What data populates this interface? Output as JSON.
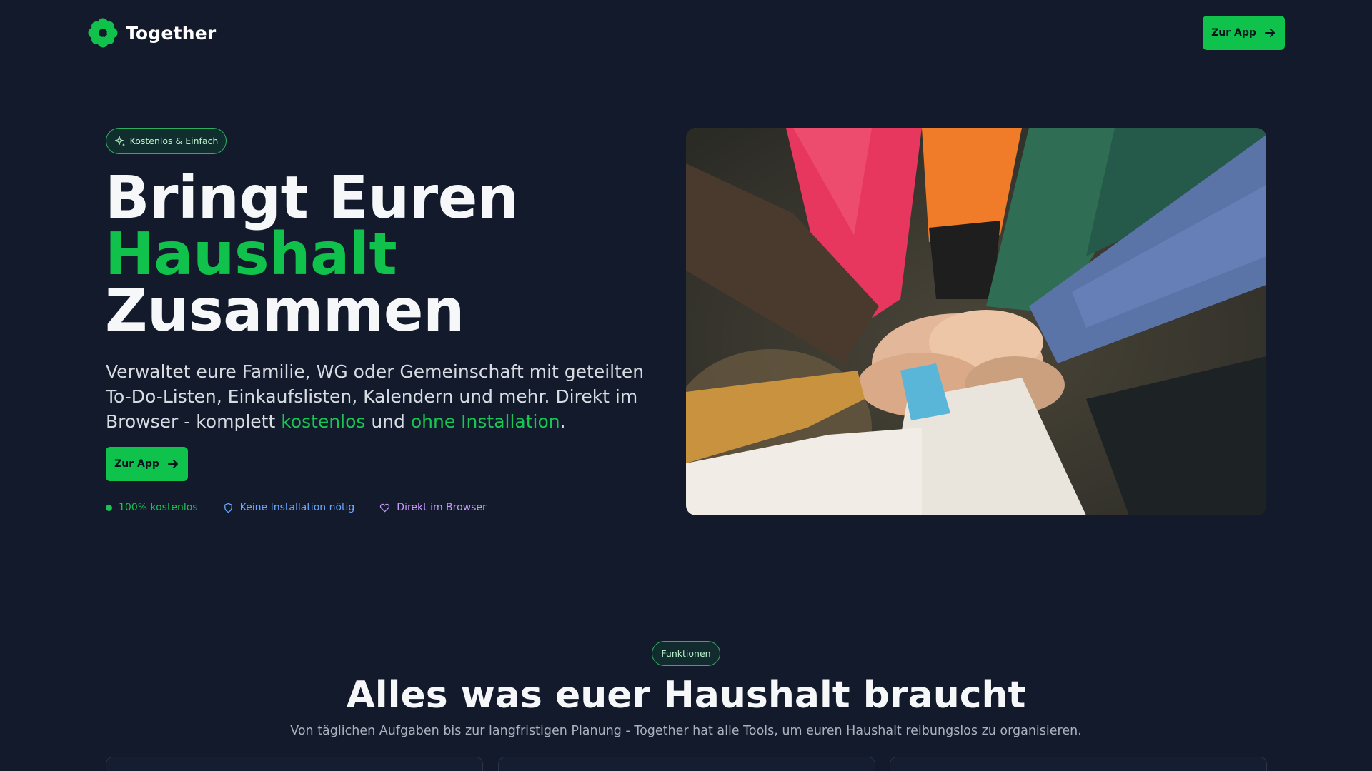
{
  "brand": {
    "name": "Together",
    "accent": "#10c24b",
    "background": "#121a2b"
  },
  "header": {
    "cta_label": "Zur App",
    "cta_icon": "arrow-right-icon"
  },
  "hero": {
    "badge": "Kostenlos & Einfach",
    "title_line1": "Bringt Euren",
    "title_line2": "Haushalt",
    "title_line3": "Zusammen",
    "desc_part1": "Verwaltet eure Familie, WG oder Gemeinschaft mit geteilten To-Do-Listen, Einkaufslisten, Kalendern und mehr. Direkt im Browser - komplett ",
    "desc_hl1": "kostenlos",
    "desc_part2": " und ",
    "desc_hl2": "ohne Installation",
    "desc_part3": ".",
    "cta_label": "Zur App",
    "features": [
      {
        "label": "100% kostenlos",
        "icon": "dot-icon",
        "color": "#19c451"
      },
      {
        "label": "Keine Installation nötig",
        "icon": "shield-icon",
        "color": "#6aa7ff"
      },
      {
        "label": "Direkt im Browser",
        "icon": "heart-icon",
        "color": "#c99aff"
      }
    ]
  },
  "features_section": {
    "badge": "Funktionen",
    "title": "Alles was euer Haushalt braucht",
    "subtitle": "Von täglichen Aufgaben bis zur langfristigen Planung - Together hat alle Tools, um euren Haushalt reibungslos zu organisieren."
  }
}
